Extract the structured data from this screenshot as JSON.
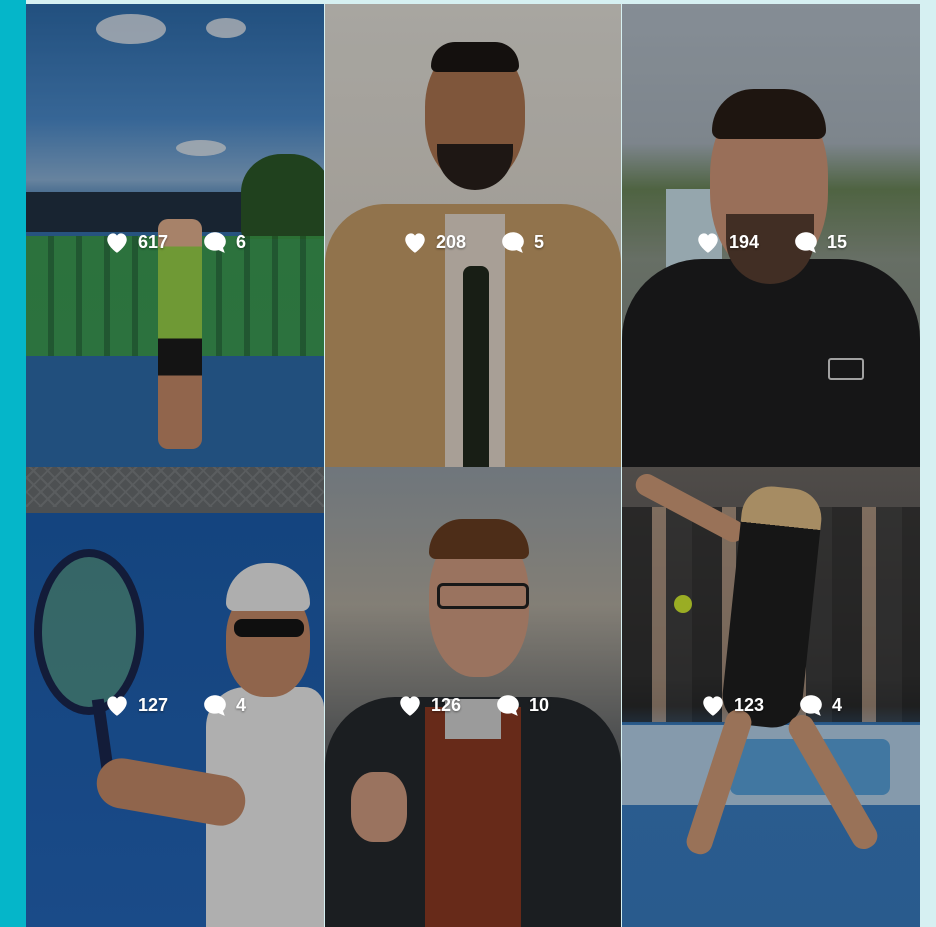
{
  "icons": {
    "like": "heart-icon",
    "comment": "comment-bubble-icon"
  },
  "colors": {
    "accent_bar": "#05b6c9",
    "page_background": "#d6f0f2",
    "overlay_text": "#ffffff"
  },
  "posts": [
    {
      "likes": "617",
      "comments": "6"
    },
    {
      "likes": "208",
      "comments": "5"
    },
    {
      "likes": "194",
      "comments": "15"
    },
    {
      "likes": "127",
      "comments": "4"
    },
    {
      "likes": "126",
      "comments": "10"
    },
    {
      "likes": "123",
      "comments": "4"
    }
  ]
}
